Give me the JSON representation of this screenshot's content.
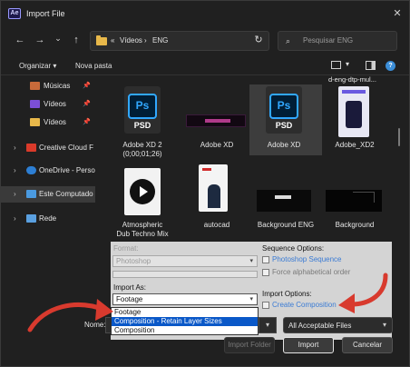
{
  "window": {
    "app_badge": "Ae",
    "title": "Import File",
    "close_glyph": "✕"
  },
  "nav": {
    "back_glyph": "←",
    "forward_glyph": "→",
    "up_glyph": "↑",
    "history_glyph": "⌄",
    "breadcrumb": [
      "«",
      "Vídeos",
      "›",
      "ENG"
    ],
    "address_chevron": "⌄",
    "refresh_glyph": "↻",
    "search_placeholder": "Pesquisar ENG"
  },
  "commandbar": {
    "organize": "Organizar ▾",
    "new_folder": "Nova pasta",
    "view_chevron": "▾",
    "help": "?"
  },
  "sidebar": {
    "items": [
      {
        "label": "Músicas",
        "icon": "music-folder-icon",
        "pinned": true
      },
      {
        "label": "Vídeos",
        "icon": "video-folder-icon",
        "pinned": true
      },
      {
        "label": "Vídeos",
        "icon": "folder-icon",
        "pinned": true
      },
      {
        "label": "Creative Cloud F",
        "icon": "creative-cloud-icon",
        "expandable": true
      },
      {
        "label": "OneDrive - Perso",
        "icon": "onedrive-icon",
        "expandable": true
      },
      {
        "label": "Este Computado",
        "icon": "computer-icon",
        "expandable": true,
        "selected": true
      },
      {
        "label": "Rede",
        "icon": "network-icon",
        "expandable": true
      }
    ],
    "pin_glyph": "📌",
    "chevron_glyph": "›"
  },
  "files": {
    "top_cut_label": "d-eng-dtp-mul...",
    "row1": [
      {
        "label_line1": "Adobe XD 2",
        "label_line2": "(0;00;01;26)",
        "type": "psd"
      },
      {
        "label_line1": "Adobe XD",
        "label_line2": "",
        "type": "thumb-dark"
      },
      {
        "label_line1": "Adobe XD",
        "label_line2": "",
        "type": "psd",
        "selected": true
      },
      {
        "label_line1": "Adobe_XD2",
        "label_line2": "",
        "type": "thumb-phone"
      }
    ],
    "row2": [
      {
        "label_line1": "Atmospheric",
        "label_line2": "Dub Techno Mix",
        "type": "audio"
      },
      {
        "label_line1": "autocad",
        "label_line2": "",
        "type": "thumb-person"
      },
      {
        "label_line1": "Background ENG",
        "label_line2": "",
        "type": "thumb-eng"
      },
      {
        "label_line1": "Background",
        "label_line2": "",
        "type": "thumb-black"
      }
    ],
    "icon_text": {
      "ps": "Ps",
      "psd": "PSD"
    }
  },
  "import_options": {
    "format_label": "Format:",
    "format_value": "Photoshop",
    "import_as_label": "Import As:",
    "import_as_value": "Footage",
    "dropdown_options": [
      "Footage",
      "Composition - Retain Layer Sizes",
      "Composition"
    ],
    "dropdown_highlight_index": 1,
    "sequence_options_label": "Sequence Options:",
    "photoshop_sequence": "Photoshop Sequence",
    "force_alphabetical": "Force alphabetical order",
    "import_options_label": "Import Options:",
    "create_composition": "Create Composition"
  },
  "bottom": {
    "name_label": "Nome:",
    "filter_value": "All Acceptable Files",
    "import_folder": "Import Folder",
    "import": "Import",
    "cancel": "Cancelar"
  },
  "colors": {
    "accent_blue": "#31a8ff",
    "highlight": "#0a58c8",
    "arrow_red": "#d83a2e"
  }
}
